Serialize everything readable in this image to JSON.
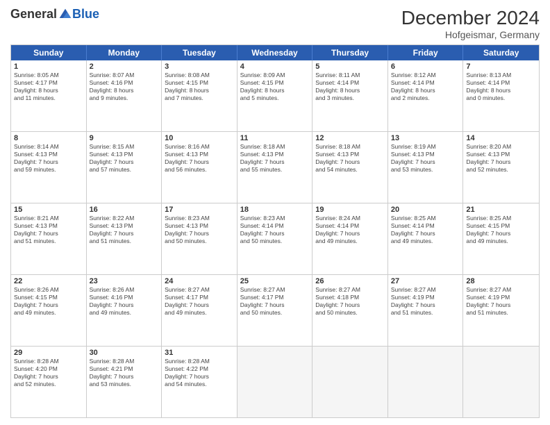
{
  "header": {
    "logo_general": "General",
    "logo_blue": "Blue",
    "month_year": "December 2024",
    "location": "Hofgeismar, Germany"
  },
  "weekdays": [
    "Sunday",
    "Monday",
    "Tuesday",
    "Wednesday",
    "Thursday",
    "Friday",
    "Saturday"
  ],
  "rows": [
    [
      {
        "day": "1",
        "info": "Sunrise: 8:05 AM\nSunset: 4:17 PM\nDaylight: 8 hours\nand 11 minutes."
      },
      {
        "day": "2",
        "info": "Sunrise: 8:07 AM\nSunset: 4:16 PM\nDaylight: 8 hours\nand 9 minutes."
      },
      {
        "day": "3",
        "info": "Sunrise: 8:08 AM\nSunset: 4:15 PM\nDaylight: 8 hours\nand 7 minutes."
      },
      {
        "day": "4",
        "info": "Sunrise: 8:09 AM\nSunset: 4:15 PM\nDaylight: 8 hours\nand 5 minutes."
      },
      {
        "day": "5",
        "info": "Sunrise: 8:11 AM\nSunset: 4:14 PM\nDaylight: 8 hours\nand 3 minutes."
      },
      {
        "day": "6",
        "info": "Sunrise: 8:12 AM\nSunset: 4:14 PM\nDaylight: 8 hours\nand 2 minutes."
      },
      {
        "day": "7",
        "info": "Sunrise: 8:13 AM\nSunset: 4:14 PM\nDaylight: 8 hours\nand 0 minutes."
      }
    ],
    [
      {
        "day": "8",
        "info": "Sunrise: 8:14 AM\nSunset: 4:13 PM\nDaylight: 7 hours\nand 59 minutes."
      },
      {
        "day": "9",
        "info": "Sunrise: 8:15 AM\nSunset: 4:13 PM\nDaylight: 7 hours\nand 57 minutes."
      },
      {
        "day": "10",
        "info": "Sunrise: 8:16 AM\nSunset: 4:13 PM\nDaylight: 7 hours\nand 56 minutes."
      },
      {
        "day": "11",
        "info": "Sunrise: 8:18 AM\nSunset: 4:13 PM\nDaylight: 7 hours\nand 55 minutes."
      },
      {
        "day": "12",
        "info": "Sunrise: 8:18 AM\nSunset: 4:13 PM\nDaylight: 7 hours\nand 54 minutes."
      },
      {
        "day": "13",
        "info": "Sunrise: 8:19 AM\nSunset: 4:13 PM\nDaylight: 7 hours\nand 53 minutes."
      },
      {
        "day": "14",
        "info": "Sunrise: 8:20 AM\nSunset: 4:13 PM\nDaylight: 7 hours\nand 52 minutes."
      }
    ],
    [
      {
        "day": "15",
        "info": "Sunrise: 8:21 AM\nSunset: 4:13 PM\nDaylight: 7 hours\nand 51 minutes."
      },
      {
        "day": "16",
        "info": "Sunrise: 8:22 AM\nSunset: 4:13 PM\nDaylight: 7 hours\nand 51 minutes."
      },
      {
        "day": "17",
        "info": "Sunrise: 8:23 AM\nSunset: 4:13 PM\nDaylight: 7 hours\nand 50 minutes."
      },
      {
        "day": "18",
        "info": "Sunrise: 8:23 AM\nSunset: 4:14 PM\nDaylight: 7 hours\nand 50 minutes."
      },
      {
        "day": "19",
        "info": "Sunrise: 8:24 AM\nSunset: 4:14 PM\nDaylight: 7 hours\nand 49 minutes."
      },
      {
        "day": "20",
        "info": "Sunrise: 8:25 AM\nSunset: 4:14 PM\nDaylight: 7 hours\nand 49 minutes."
      },
      {
        "day": "21",
        "info": "Sunrise: 8:25 AM\nSunset: 4:15 PM\nDaylight: 7 hours\nand 49 minutes."
      }
    ],
    [
      {
        "day": "22",
        "info": "Sunrise: 8:26 AM\nSunset: 4:15 PM\nDaylight: 7 hours\nand 49 minutes."
      },
      {
        "day": "23",
        "info": "Sunrise: 8:26 AM\nSunset: 4:16 PM\nDaylight: 7 hours\nand 49 minutes."
      },
      {
        "day": "24",
        "info": "Sunrise: 8:27 AM\nSunset: 4:17 PM\nDaylight: 7 hours\nand 49 minutes."
      },
      {
        "day": "25",
        "info": "Sunrise: 8:27 AM\nSunset: 4:17 PM\nDaylight: 7 hours\nand 50 minutes."
      },
      {
        "day": "26",
        "info": "Sunrise: 8:27 AM\nSunset: 4:18 PM\nDaylight: 7 hours\nand 50 minutes."
      },
      {
        "day": "27",
        "info": "Sunrise: 8:27 AM\nSunset: 4:19 PM\nDaylight: 7 hours\nand 51 minutes."
      },
      {
        "day": "28",
        "info": "Sunrise: 8:27 AM\nSunset: 4:19 PM\nDaylight: 7 hours\nand 51 minutes."
      }
    ],
    [
      {
        "day": "29",
        "info": "Sunrise: 8:28 AM\nSunset: 4:20 PM\nDaylight: 7 hours\nand 52 minutes."
      },
      {
        "day": "30",
        "info": "Sunrise: 8:28 AM\nSunset: 4:21 PM\nDaylight: 7 hours\nand 53 minutes."
      },
      {
        "day": "31",
        "info": "Sunrise: 8:28 AM\nSunset: 4:22 PM\nDaylight: 7 hours\nand 54 minutes."
      },
      {
        "day": "",
        "info": ""
      },
      {
        "day": "",
        "info": ""
      },
      {
        "day": "",
        "info": ""
      },
      {
        "day": "",
        "info": ""
      }
    ]
  ]
}
